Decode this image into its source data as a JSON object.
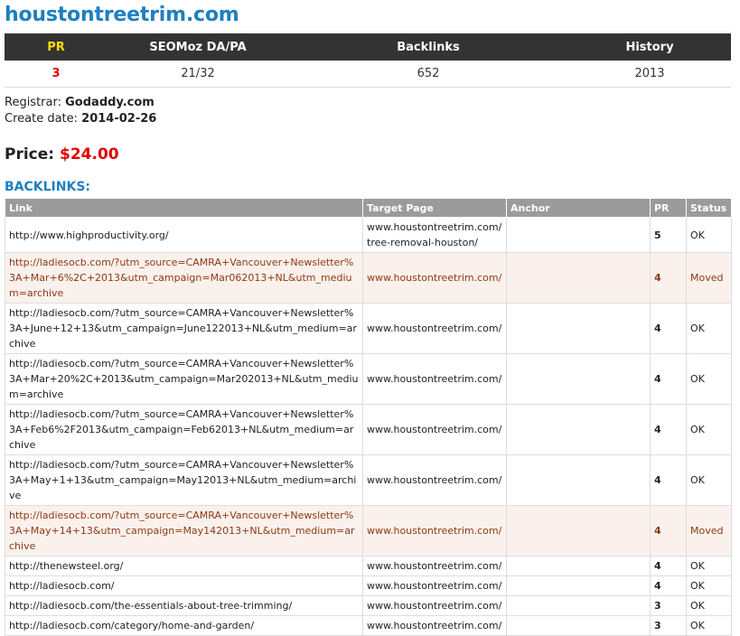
{
  "domain": "houstontreetrim.com",
  "stats": {
    "headers": [
      "PR",
      "SEOMoz DA/PA",
      "Backlinks",
      "History"
    ],
    "values": [
      "3",
      "21/32",
      "652",
      "2013"
    ]
  },
  "registrar": {
    "label": "Registrar:",
    "value": "Godaddy.com"
  },
  "create_date": {
    "label": "Create date:",
    "value": "2014-02-26"
  },
  "price": {
    "label": "Price:",
    "value": "$24.00"
  },
  "backlinks_heading": "BACKLINKS:",
  "backlinks": {
    "headers": [
      "Link",
      "Target Page",
      "Anchor",
      "PR",
      "Status"
    ],
    "rows": [
      {
        "link": "http://www.highproductivity.org/",
        "target": "www.houstontreetrim.com/tree-removal-houston/",
        "anchor": "",
        "pr": "5",
        "status": "OK"
      },
      {
        "link": "http://ladiesocb.com/?utm_source=CAMRA+Vancouver+Newsletter%3A+Mar+6%2C+2013&utm_campaign=Mar062013+NL&utm_medium=archive",
        "target": "www.houstontreetrim.com/",
        "anchor": "",
        "pr": "4",
        "status": "Moved"
      },
      {
        "link": "http://ladiesocb.com/?utm_source=CAMRA+Vancouver+Newsletter%3A+June+12+13&utm_campaign=June122013+NL&utm_medium=archive",
        "target": "www.houstontreetrim.com/",
        "anchor": "",
        "pr": "4",
        "status": "OK"
      },
      {
        "link": "http://ladiesocb.com/?utm_source=CAMRA+Vancouver+Newsletter%3A+Mar+20%2C+2013&utm_campaign=Mar202013+NL&utm_medium=archive",
        "target": "www.houstontreetrim.com/",
        "anchor": "",
        "pr": "4",
        "status": "OK"
      },
      {
        "link": "http://ladiesocb.com/?utm_source=CAMRA+Vancouver+Newsletter%3A+Feb6%2F2013&utm_campaign=Feb62013+NL&utm_medium=archive",
        "target": "www.houstontreetrim.com/",
        "anchor": "",
        "pr": "4",
        "status": "OK"
      },
      {
        "link": "http://ladiesocb.com/?utm_source=CAMRA+Vancouver+Newsletter%3A+May+1+13&utm_campaign=May12013+NL&utm_medium=archive",
        "target": "www.houstontreetrim.com/",
        "anchor": "",
        "pr": "4",
        "status": "OK"
      },
      {
        "link": "http://ladiesocb.com/?utm_source=CAMRA+Vancouver+Newsletter%3A+May+14+13&utm_campaign=May142013+NL&utm_medium=archive",
        "target": "www.houstontreetrim.com/",
        "anchor": "",
        "pr": "4",
        "status": "Moved"
      },
      {
        "link": "http://thenewsteel.org/",
        "target": "www.houstontreetrim.com/",
        "anchor": "",
        "pr": "4",
        "status": "OK"
      },
      {
        "link": "http://ladiesocb.com/",
        "target": "www.houstontreetrim.com/",
        "anchor": "",
        "pr": "4",
        "status": "OK"
      },
      {
        "link": "http://ladiesocb.com/the-essentials-about-tree-trimming/",
        "target": "www.houstontreetrim.com/",
        "anchor": "",
        "pr": "3",
        "status": "OK"
      },
      {
        "link": "http://ladiesocb.com/category/home-and-garden/",
        "target": "www.houstontreetrim.com/",
        "anchor": "",
        "pr": "3",
        "status": "OK"
      }
    ]
  }
}
